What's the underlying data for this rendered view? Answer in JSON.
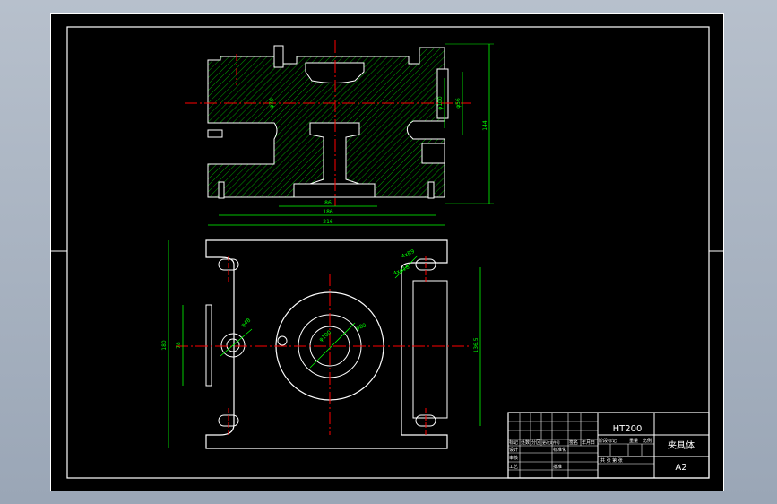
{
  "drawing": {
    "material": "HT200",
    "part_name": "夹具体",
    "sheet_size": "A2"
  },
  "dimensions": {
    "top_view": {
      "width_86": "86",
      "width_186": "186",
      "width_216": "216",
      "height_144": "144",
      "dia_phi56": "φ56",
      "dia_phi100": "φ100",
      "dia_phi70": "φ70"
    },
    "plan_view": {
      "height_180": "180",
      "height_78": "78",
      "height_136": "136.5",
      "dia_phi48": "φ48",
      "dia_phi80": "φ80",
      "dia_phi100": "φ100",
      "slot_r": "4xR9",
      "slot_w": "4xφ18"
    }
  },
  "title_block": {
    "row_labels": [
      "标记",
      "处数",
      "分区",
      "更改文件号",
      "签名",
      "年月日"
    ],
    "design": "设计",
    "standardize": "标准化",
    "review": "审核",
    "craft": "工艺",
    "approve": "批准",
    "stage_mark": "阶段标记",
    "weight": "重量",
    "scale": "比例",
    "sheets": "共 张 第 张"
  },
  "colors": {
    "sheet": "#000000",
    "outline": "#ffffff",
    "hatch": "#00ff00",
    "centerline": "#ff0000",
    "dimension": "#00ff00",
    "ui_frame": "#a9b4c3"
  }
}
